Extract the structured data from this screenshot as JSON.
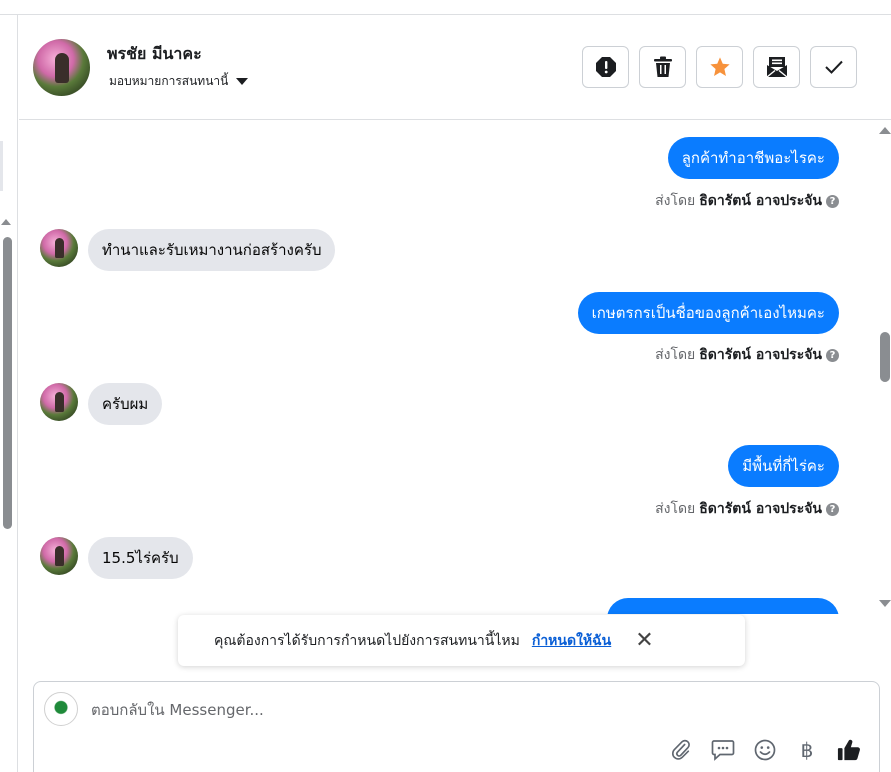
{
  "header": {
    "contact_name": "พรชัย มีนาคะ",
    "assign_label": "มอบหมายการสนทนานี้"
  },
  "actions": [
    {
      "name": "spam-button",
      "icon": "alert-icon"
    },
    {
      "name": "delete-button",
      "icon": "trash-icon"
    },
    {
      "name": "star-button",
      "icon": "star-icon"
    },
    {
      "name": "mark-unread-button",
      "icon": "envelope-icon"
    },
    {
      "name": "done-button",
      "icon": "check-icon"
    }
  ],
  "colors": {
    "accent": "#0a7cff",
    "star": "#f7923b",
    "incoming_bubble": "#e4e6eb"
  },
  "thread": {
    "sent_by_prefix": "ส่งโดย",
    "sender_name": "ธิดารัตน์ อาจประจัน",
    "messages": [
      {
        "direction": "out",
        "text": "ลูกค้าทำอาชีพอะไรคะ"
      },
      {
        "direction": "in",
        "text": "ทำนาและรับเหมางานก่อสร้างครับ"
      },
      {
        "direction": "out",
        "text": "เกษตรกรเป็นชื่อของลูกค้าเองไหมคะ"
      },
      {
        "direction": "in",
        "text": "ครับผม"
      },
      {
        "direction": "out",
        "text": "มีพื้นที่กี่ไร่คะ"
      },
      {
        "direction": "in",
        "text": "15.5ไร่ครับ"
      }
    ]
  },
  "assign_bar": {
    "question": "คุณต้องการได้รับการกำหนดไปยังการสนทนานี้ไหม",
    "link": "กำหนดให้ฉัน"
  },
  "composer": {
    "placeholder": "ตอบกลับใน Messenger...",
    "currency_symbol": "฿"
  }
}
